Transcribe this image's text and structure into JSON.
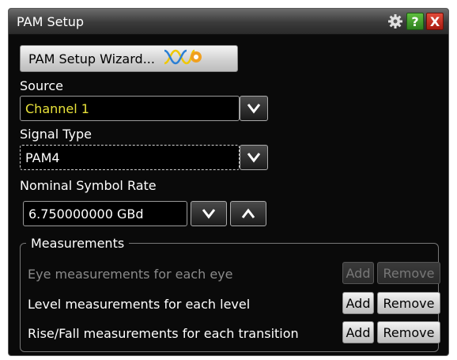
{
  "window": {
    "title": "PAM Setup",
    "icons": {
      "gear": "gear-icon",
      "help": "?",
      "close": "X"
    }
  },
  "wizard": {
    "label": "PAM Setup Wizard...",
    "icon": "wizard-waveform-gear-icon"
  },
  "source": {
    "label": "Source",
    "value": "Channel 1",
    "value_color": "#e8e23a"
  },
  "signal_type": {
    "label": "Signal Type",
    "value": "PAM4"
  },
  "symbol_rate": {
    "label": "Nominal Symbol Rate",
    "value": "6.750000000 GBd"
  },
  "measurements": {
    "title": "Measurements",
    "rows": [
      {
        "label": "Eye measurements for each eye",
        "add": "Add",
        "remove": "Remove",
        "enabled": false
      },
      {
        "label": "Level measurements for each level",
        "add": "Add",
        "remove": "Remove",
        "enabled": true
      },
      {
        "label": "Rise/Fall measurements for each transition",
        "add": "Add",
        "remove": "Remove",
        "enabled": true
      }
    ]
  }
}
